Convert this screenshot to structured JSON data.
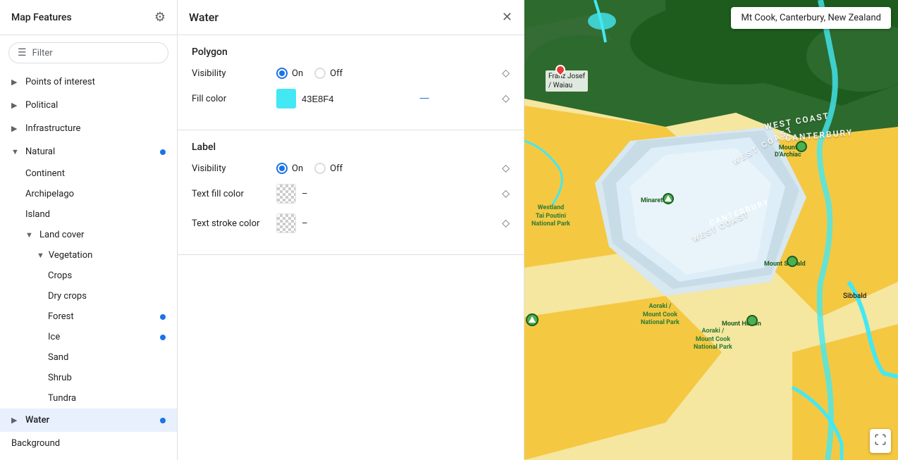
{
  "sidebar": {
    "title": "Map Features",
    "filter_placeholder": "Filter",
    "items": [
      {
        "id": "points-of-interest",
        "label": "Points of interest",
        "type": "collapsed",
        "level": 0
      },
      {
        "id": "political",
        "label": "Political",
        "type": "collapsed",
        "level": 0
      },
      {
        "id": "infrastructure",
        "label": "Infrastructure",
        "type": "collapsed",
        "level": 0
      },
      {
        "id": "natural",
        "label": "Natural",
        "type": "expanded",
        "level": 0,
        "has_dot": true
      },
      {
        "id": "continent",
        "label": "Continent",
        "type": "leaf",
        "level": 1
      },
      {
        "id": "archipelago",
        "label": "Archipelago",
        "type": "leaf",
        "level": 1
      },
      {
        "id": "island",
        "label": "Island",
        "type": "leaf",
        "level": 1
      },
      {
        "id": "land-cover",
        "label": "Land cover",
        "type": "expanded",
        "level": 1
      },
      {
        "id": "vegetation",
        "label": "Vegetation",
        "type": "expanded",
        "level": 2
      },
      {
        "id": "crops",
        "label": "Crops",
        "type": "deep-leaf",
        "level": 3
      },
      {
        "id": "dry-crops",
        "label": "Dry crops",
        "type": "deep-leaf",
        "level": 3
      },
      {
        "id": "forest",
        "label": "Forest",
        "type": "deep-leaf",
        "level": 3,
        "has_dot": true
      },
      {
        "id": "ice",
        "label": "Ice",
        "type": "deep-leaf",
        "level": 3,
        "has_dot": true
      },
      {
        "id": "sand",
        "label": "Sand",
        "type": "deep-leaf",
        "level": 3
      },
      {
        "id": "shrub",
        "label": "Shrub",
        "type": "deep-leaf",
        "level": 3
      },
      {
        "id": "tundra",
        "label": "Tundra",
        "type": "deep-leaf",
        "level": 3
      },
      {
        "id": "water",
        "label": "Water",
        "type": "active",
        "level": 0,
        "has_dot": true
      },
      {
        "id": "background",
        "label": "Background",
        "type": "leaf-root",
        "level": 0
      }
    ]
  },
  "panel": {
    "title": "Water",
    "sections": [
      {
        "id": "polygon",
        "title": "Polygon",
        "visibility_label": "Visibility",
        "visibility_on_label": "On",
        "visibility_off_label": "Off",
        "visibility_value": "on",
        "fill_color_label": "Fill color",
        "fill_color_hex": "43E8F4",
        "fill_color_swatch": "#43E8F4"
      },
      {
        "id": "label",
        "title": "Label",
        "visibility_label": "Visibility",
        "visibility_on_label": "On",
        "visibility_off_label": "Off",
        "visibility_value": "on",
        "text_fill_label": "Text fill color",
        "text_fill_value": "–",
        "text_stroke_label": "Text stroke color",
        "text_stroke_value": "–"
      }
    ]
  },
  "map": {
    "search_value": "Mt Cook, Canterbury, New Zealand"
  }
}
